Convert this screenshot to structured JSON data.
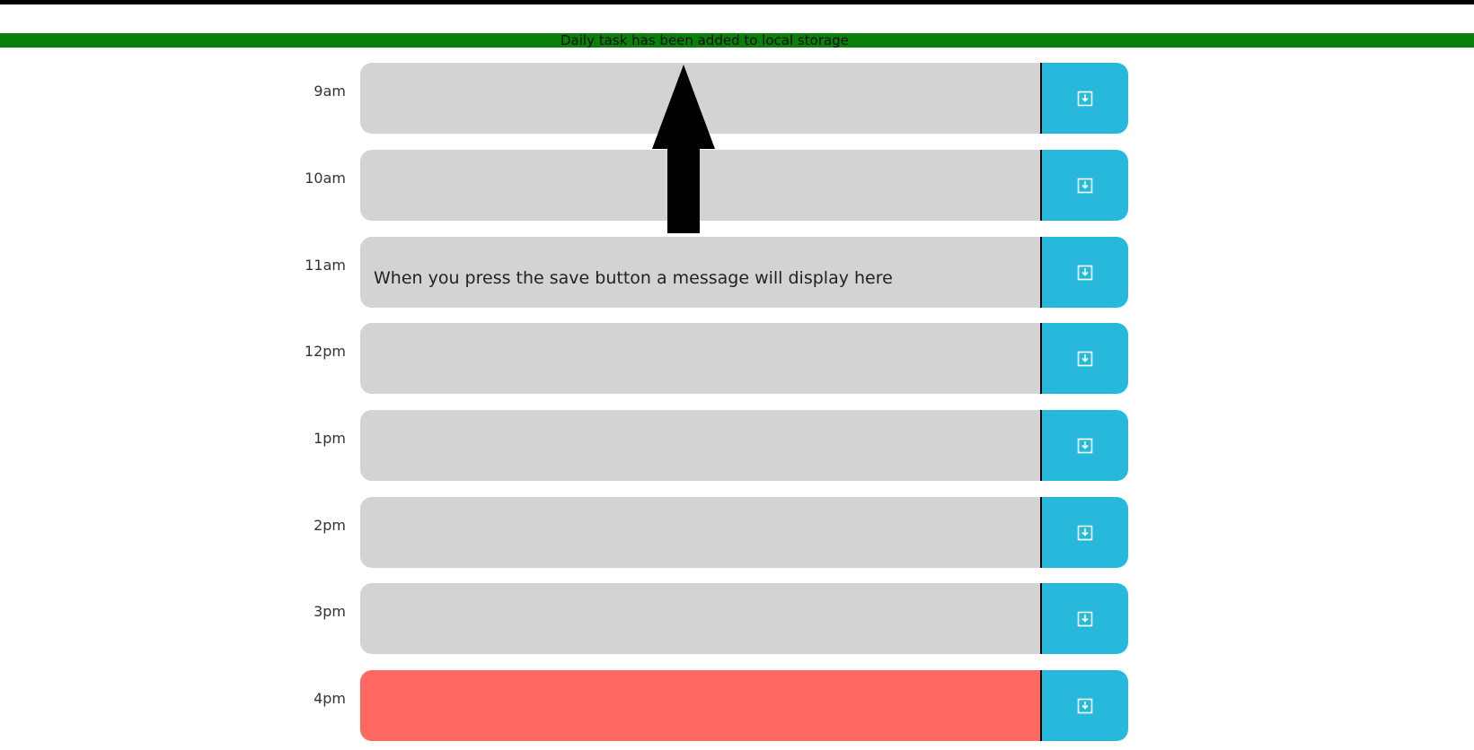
{
  "notice": {
    "message": "Daily task has been added to local storage",
    "bar_color": "#0b7f0b"
  },
  "rows": [
    {
      "hour": "9am",
      "text": "",
      "status": "past"
    },
    {
      "hour": "10am",
      "text": "",
      "status": "past"
    },
    {
      "hour": "11am",
      "text": "When you press the save button a message will display here",
      "status": "past"
    },
    {
      "hour": "12pm",
      "text": "",
      "status": "past"
    },
    {
      "hour": "1pm",
      "text": "",
      "status": "past"
    },
    {
      "hour": "2pm",
      "text": "",
      "status": "past"
    },
    {
      "hour": "3pm",
      "text": "",
      "status": "past"
    },
    {
      "hour": "4pm",
      "text": "",
      "status": "present"
    }
  ],
  "save_icon": "save-icon",
  "colors": {
    "past": "#d3d3d3",
    "present": "#ff6961",
    "save": "#27b9db"
  }
}
